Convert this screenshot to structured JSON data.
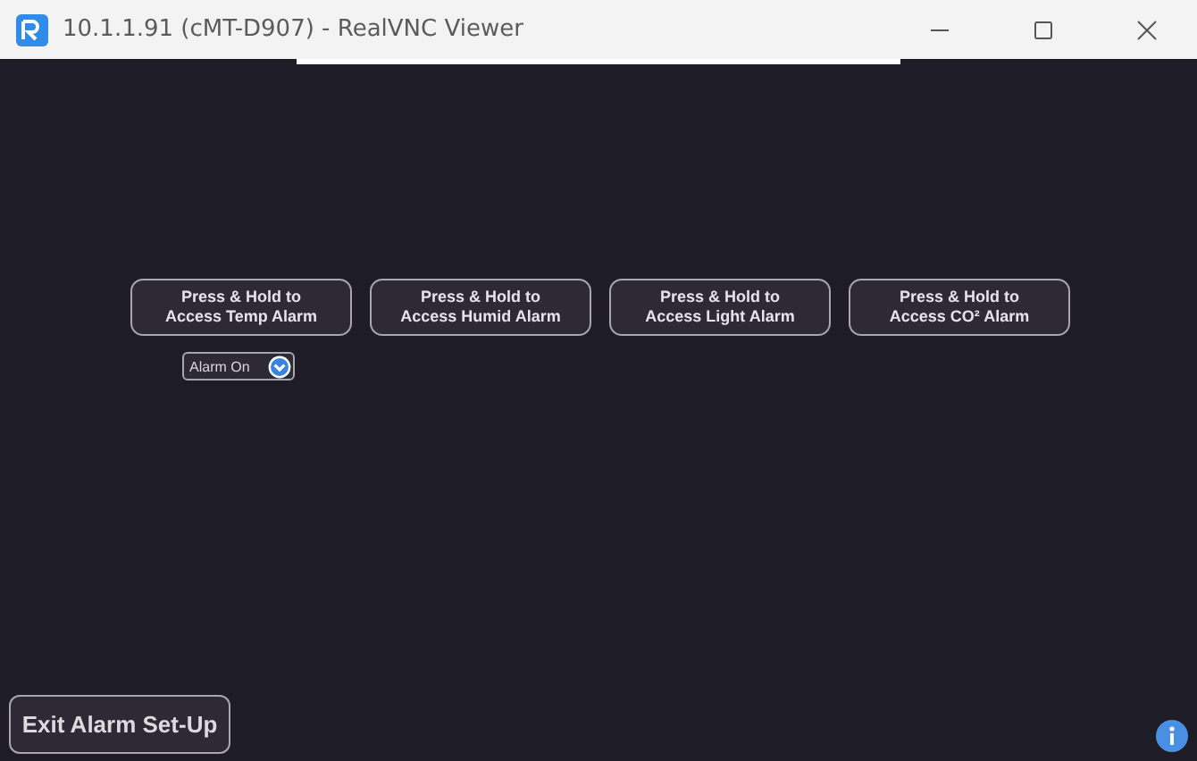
{
  "window": {
    "title": "10.1.1.91 (cMT-D907) - RealVNC Viewer"
  },
  "alarm_buttons": [
    "Press & Hold to\nAccess Temp Alarm",
    "Press & Hold to\nAccess Humid Alarm",
    "Press & Hold to\nAccess Light Alarm",
    "Press & Hold to\nAccess CO² Alarm"
  ],
  "alarm_dropdown": {
    "value": "Alarm On"
  },
  "exit_button": "Exit Alarm Set-Up"
}
